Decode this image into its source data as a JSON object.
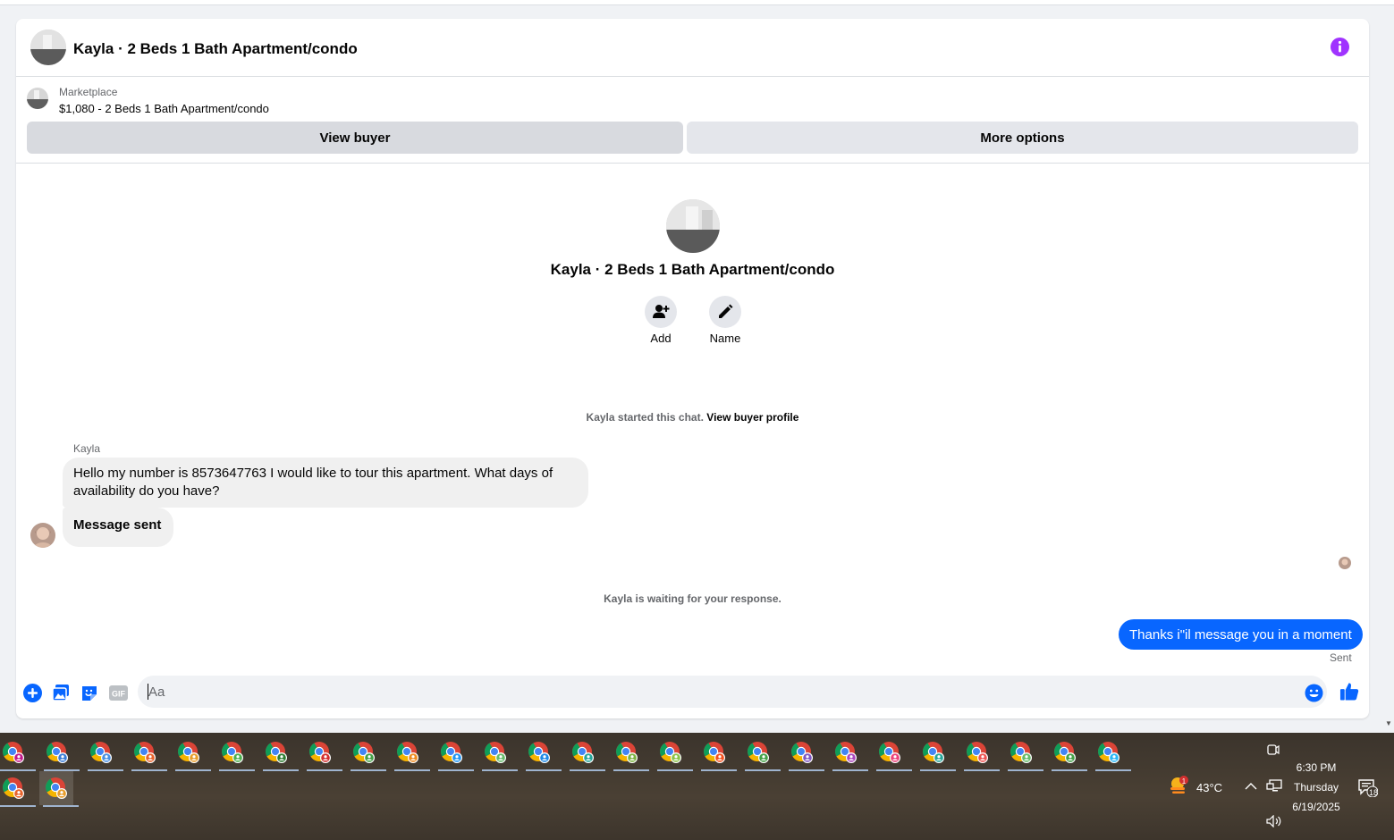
{
  "header": {
    "title": "Kayla · 2 Beds 1 Bath Apartment/condo",
    "info_icon": "info-icon"
  },
  "listing": {
    "label": "Marketplace",
    "price_title": "$1,080 - 2 Beds 1 Bath Apartment/condo",
    "view_buyer_label": "View buyer",
    "more_options_label": "More options"
  },
  "intro": {
    "title": "Kayla · 2 Beds 1 Bath Apartment/condo",
    "add_label": "Add",
    "name_label": "Name"
  },
  "chat": {
    "started_text": "Kayla started this chat.",
    "view_buyer_profile": "View buyer profile",
    "sender_name": "Kayla",
    "message_1": "Hello my number is 8573647763 I would like to tour this apartment. What days of availability do you have?",
    "message_2": "Message sent",
    "waiting_text": "Kayla is waiting for your response.",
    "my_message": "Thanks i\"il message you in a moment",
    "sent_status": "Sent"
  },
  "composer": {
    "placeholder": "Aa"
  },
  "taskbar": {
    "weather_temp": "43°C",
    "weather_badge": "1",
    "time": "6:30 PM",
    "day": "Thursday",
    "date": "6/19/2025",
    "notification_count": "18",
    "profile_badge_colors": [
      "#c2188b",
      "#3a7bd5",
      "#4a90e2",
      "#e8632b",
      "#e89d2b",
      "#4caf50",
      "#2e7d32",
      "#d32f2f",
      "#43a047",
      "#ef8a1e",
      "#2196f3",
      "#66bb6a",
      "#1e88e5",
      "#26a69a",
      "#7cb342",
      "#8bc34a",
      "#f4511e",
      "#43a047",
      "#7e57c2",
      "#ab47bc",
      "#ec407a",
      "#26a69a",
      "#ef5350",
      "#66bb6a",
      "#43a047",
      "#29b6f6"
    ]
  },
  "colors": {
    "accent_blue": "#0866ff",
    "info_purple": "#a033ff"
  }
}
